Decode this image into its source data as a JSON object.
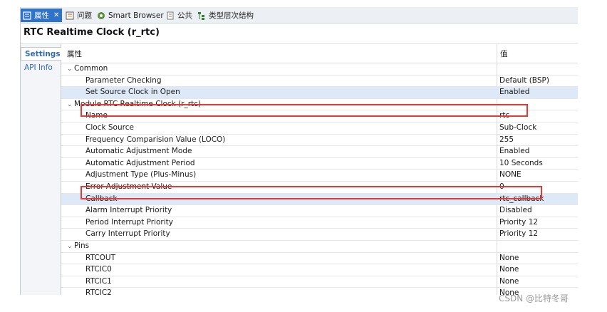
{
  "tabs": [
    {
      "label": "属性",
      "icon": "properties-icon",
      "active": true
    },
    {
      "label": "问题",
      "icon": "problems-icon"
    },
    {
      "label": "Smart Browser",
      "icon": "smart-browser-icon"
    },
    {
      "label": "公共",
      "icon": "common-icon"
    },
    {
      "label": "类型层次结构",
      "icon": "type-hierarchy-icon"
    }
  ],
  "title": "RTC Realtime Clock (r_rtc)",
  "side_tabs": [
    "Settings",
    "API Info"
  ],
  "header": {
    "property": "属性",
    "value": "值"
  },
  "groups": {
    "common": "Common",
    "module": "Module RTC Realtime Clock (r_rtc)",
    "pins": "Pins"
  },
  "rows": {
    "parameter_checking": {
      "key": "Parameter Checking",
      "value": "Default (BSP)"
    },
    "set_source_clock": {
      "key": "Set Source Clock in Open",
      "value": "Enabled"
    },
    "name": {
      "key": "Name",
      "value": "rtc"
    },
    "clock_source": {
      "key": "Clock Source",
      "value": "Sub-Clock"
    },
    "freq_comparision": {
      "key": "Frequency Comparision Value (LOCO)",
      "value": "255"
    },
    "auto_adj_mode": {
      "key": "Automatic Adjustment Mode",
      "value": "Enabled"
    },
    "auto_adj_period": {
      "key": "Automatic Adjustment Period",
      "value": "10 Seconds"
    },
    "adj_type": {
      "key": "Adjustment Type (Plus-Minus)",
      "value": "NONE"
    },
    "error_adj_value": {
      "key": "Error Adjustment Value",
      "value": "0"
    },
    "callback": {
      "key": "Callback",
      "value": "rtc_callback"
    },
    "alarm_irq": {
      "key": "Alarm Interrupt Priority",
      "value": "Disabled"
    },
    "period_irq": {
      "key": "Period Interrupt Priority",
      "value": "Priority 12"
    },
    "carry_irq": {
      "key": "Carry Interrupt Priority",
      "value": "Priority 12"
    },
    "rtcout": {
      "key": "RTCOUT",
      "value": "None"
    },
    "rtcic0": {
      "key": "RTCIC0",
      "value": "None"
    },
    "rtcic1": {
      "key": "RTCIC1",
      "value": "None"
    },
    "rtcic2": {
      "key": "RTCIC2",
      "value": "None"
    }
  },
  "watermark": "CSDN @比特冬哥",
  "colors": {
    "accent": "#2f73c8",
    "highlight": "#dde9f7",
    "annotation": "#e53935"
  }
}
